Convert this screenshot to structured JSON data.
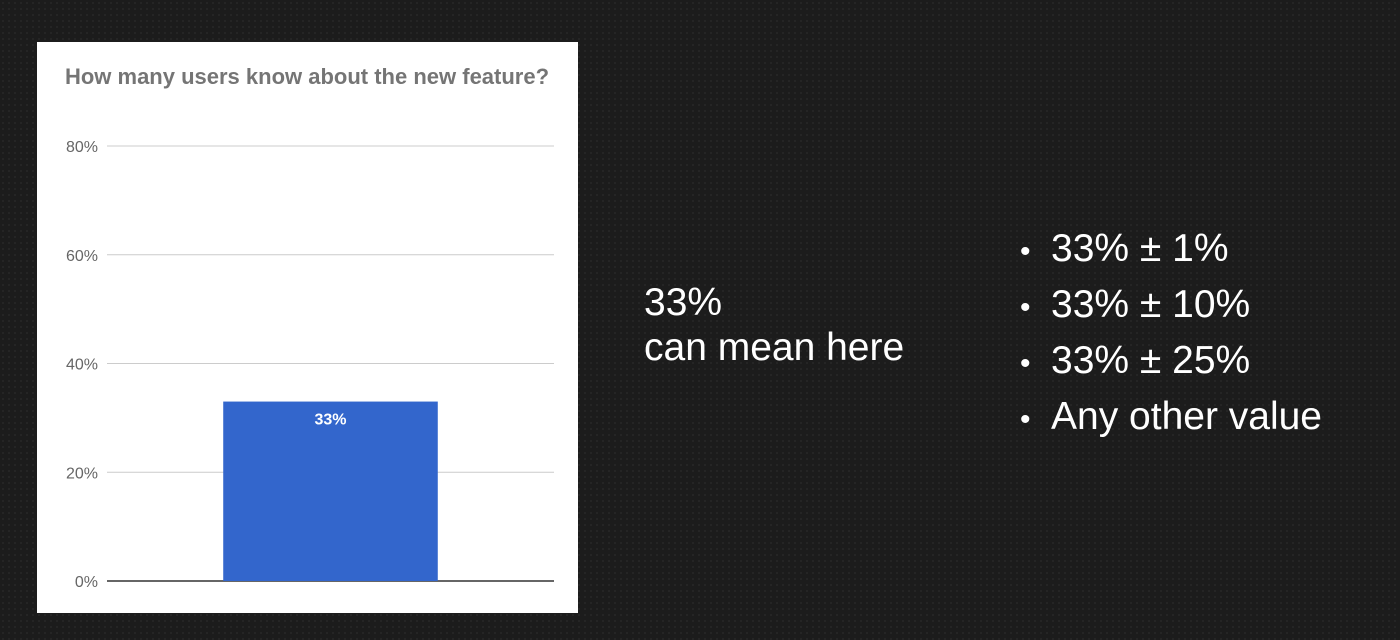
{
  "chart_data": {
    "type": "bar",
    "title": "How many users know about the new feature?",
    "categories": [
      ""
    ],
    "values": [
      33
    ],
    "data_labels": [
      "33%"
    ],
    "ylim": [
      0,
      80
    ],
    "yticks": [
      0,
      20,
      40,
      60,
      80
    ],
    "ytick_labels": [
      "0%",
      "20%",
      "40%",
      "60%",
      "80%"
    ],
    "xlabel": "",
    "ylabel": "",
    "grid": true,
    "bar_color": "#3366cc",
    "gridline_color": "#cccccc",
    "axis_text_color": "#666666",
    "data_label_color": "#ffffff"
  },
  "main_text": {
    "line1": "33%",
    "line2": "can mean here"
  },
  "bullets": {
    "symbol": "•",
    "items": [
      "33% ± 1%",
      "33% ± 10%",
      "33% ± 25%",
      "Any other value"
    ]
  }
}
